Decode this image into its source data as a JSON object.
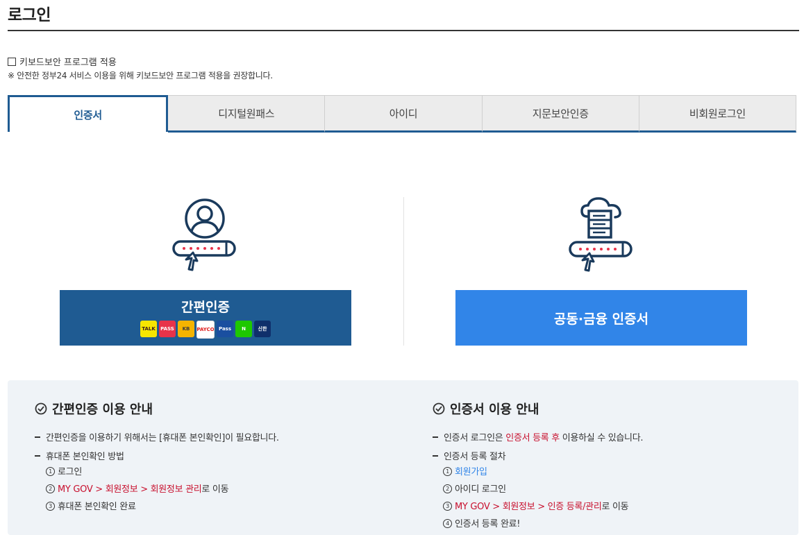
{
  "page": {
    "title": "로그인"
  },
  "keyboard_security": {
    "checkbox_label": "키보드보안 프로그램 적용",
    "notice": "※ 안전한 정부24 서비스 이용을 위해 키보드보안 프로그램 적용을 권장합니다."
  },
  "tabs": [
    {
      "label": "인증서",
      "active": true
    },
    {
      "label": "디지털원패스"
    },
    {
      "label": "아이디"
    },
    {
      "label": "지문보안인증"
    },
    {
      "label": "비회원로그인"
    }
  ],
  "simple_auth": {
    "button_label": "간편인증",
    "providers": [
      {
        "text": "TALK",
        "icon": "kakao-icon",
        "bg": "#f7e600",
        "fg": "#3a1d1d"
      },
      {
        "text": "PASS",
        "icon": "pass-icon",
        "bg": "#e8334a",
        "fg": "#ffffff"
      },
      {
        "text": "KB",
        "icon": "kb-icon",
        "bg": "#f5b400",
        "fg": "#3b3b3b"
      },
      {
        "text": "PAYCO",
        "icon": "payco-icon",
        "bg": "#ffffff",
        "fg": "#e02020"
      },
      {
        "text": "Pass",
        "icon": "samsung-pass-icon",
        "bg": "#1a4fa0",
        "fg": "#ffffff"
      },
      {
        "text": "N",
        "icon": "naver-icon",
        "bg": "#1ec800",
        "fg": "#ffffff"
      },
      {
        "text": "신한",
        "icon": "shinhan-icon",
        "bg": "#0f2f6b",
        "fg": "#ffffff"
      }
    ]
  },
  "cert_auth": {
    "button_label": "공동·금융 인증서"
  },
  "guide_simple": {
    "heading": "간편인증 이용 안내",
    "item1": "간편인증을 이용하기 위해서는 [휴대폰 본인확인]이 필요합니다.",
    "item2": "휴대폰 본인확인 방법",
    "step1_num": "1",
    "step1": "로그인",
    "step2_num": "2",
    "step2_path": "MY GOV > 회원정보 > 회원정보 관리",
    "step2_suffix": "로 이동",
    "step3_num": "3",
    "step3": "휴대폰 본인확인 완료"
  },
  "guide_cert": {
    "heading": "인증서 이용 안내",
    "item1_prefix": "인증서 로그인은 ",
    "item1_highlight": "인증서 등록 후",
    "item1_suffix": " 이용하실 수 있습니다.",
    "item2": "인증서 등록 절차",
    "step1_num": "1",
    "step1_link": "회원가입",
    "step2_num": "2",
    "step2": "아이디 로그인",
    "step3_num": "3",
    "step3_path": "MY GOV > 회원정보 > 인증 등록/관리",
    "step3_suffix": "로 이동",
    "step4_num": "4",
    "step4": "인증서 등록 완료!"
  },
  "colors": {
    "primary": "#1f5b92",
    "accent": "#3185e8",
    "highlight": "#c8102e",
    "guide_bg": "#eff3f7"
  }
}
